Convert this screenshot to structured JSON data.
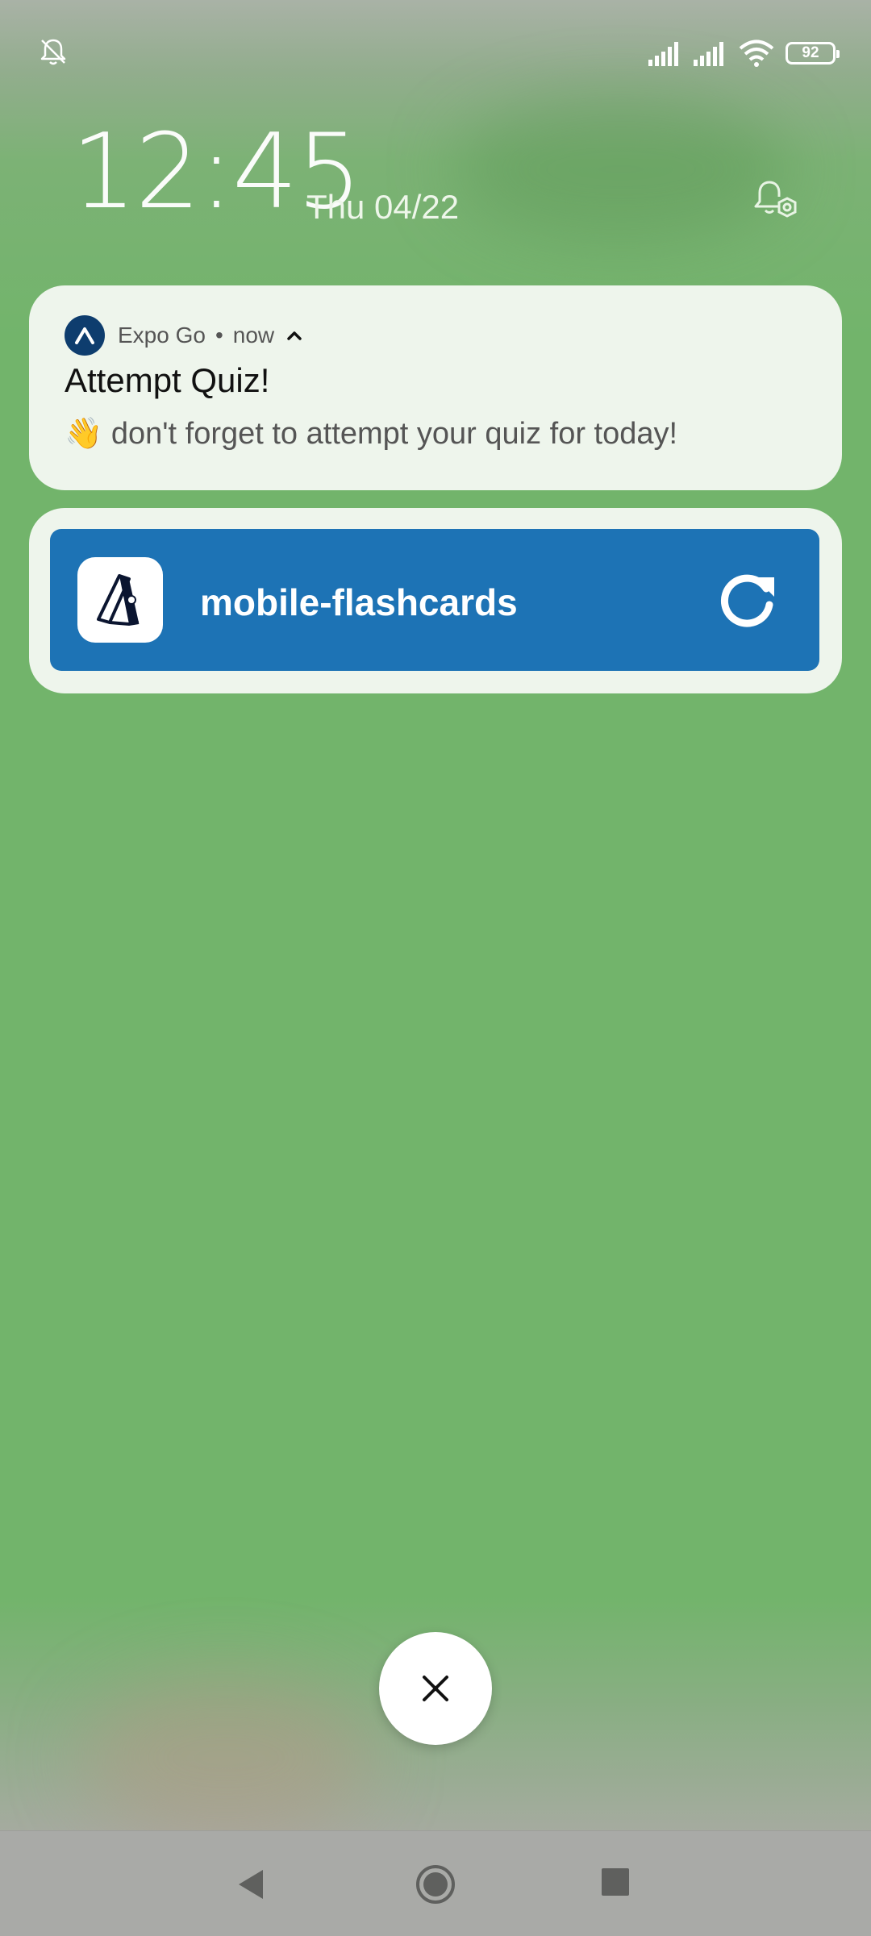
{
  "status_bar": {
    "battery_level": "92",
    "icons": [
      "alarm-off-icon",
      "signal-icon",
      "signal-icon",
      "wifi-icon",
      "battery-icon"
    ]
  },
  "lockscreen": {
    "time": "12:45",
    "date": "Thu 04/22",
    "settings_icon": "notification-settings-icon"
  },
  "notification": {
    "app_name": "Expo Go",
    "separator": "•",
    "time": "now",
    "title": "Attempt Quiz!",
    "body": "👋 don't forget to attempt your quiz for today!"
  },
  "app_card": {
    "name": "mobile-flashcards",
    "reload_icon": "reload-icon",
    "colors": {
      "bar": "#1d73b5"
    }
  },
  "colors": {
    "wallpaper": "#72b46b",
    "card": "#eef5ec",
    "expo_icon": "#0e3d6e"
  }
}
